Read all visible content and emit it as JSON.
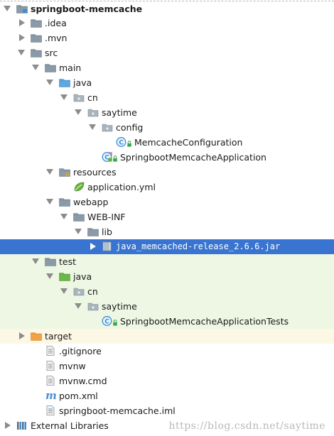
{
  "tree": [
    {
      "label": "springboot-memcache",
      "level": 0,
      "arrow": "open",
      "icon": "module-folder-icon",
      "bold": true,
      "top": true
    },
    {
      "label": ".idea",
      "level": 1,
      "arrow": "closed",
      "icon": "folder-icon"
    },
    {
      "label": ".mvn",
      "level": 1,
      "arrow": "closed",
      "icon": "folder-icon"
    },
    {
      "label": "src",
      "level": 1,
      "arrow": "open",
      "icon": "folder-icon"
    },
    {
      "label": "main",
      "level": 2,
      "arrow": "open",
      "icon": "folder-icon"
    },
    {
      "label": "java",
      "level": 3,
      "arrow": "open",
      "icon": "source-folder-icon"
    },
    {
      "label": "cn",
      "level": 4,
      "arrow": "open",
      "icon": "package-icon"
    },
    {
      "label": "saytime",
      "level": 5,
      "arrow": "open",
      "icon": "package-icon"
    },
    {
      "label": "config",
      "level": 6,
      "arrow": "open",
      "icon": "package-icon"
    },
    {
      "label": "MemcacheConfiguration",
      "level": 7,
      "arrow": "none",
      "icon": "class-icon",
      "lock": true
    },
    {
      "label": "SpringbootMemcacheApplication",
      "level": 6,
      "arrow": "none",
      "icon": "spring-boot-class-icon",
      "lock": true
    },
    {
      "label": "resources",
      "level": 3,
      "arrow": "open",
      "icon": "resources-folder-icon"
    },
    {
      "label": "application.yml",
      "level": 4,
      "arrow": "none",
      "icon": "spring-leaf-icon"
    },
    {
      "label": "webapp",
      "level": 3,
      "arrow": "open",
      "icon": "folder-icon"
    },
    {
      "label": "WEB-INF",
      "level": 4,
      "arrow": "open",
      "icon": "folder-icon"
    },
    {
      "label": "lib",
      "level": 5,
      "arrow": "open",
      "icon": "folder-icon"
    },
    {
      "label": "java_memcached-release_2.6.6.jar",
      "level": 6,
      "arrow": "closed",
      "icon": "jar-icon",
      "selected": true,
      "mono": true
    },
    {
      "label": "test",
      "level": 2,
      "arrow": "open",
      "icon": "folder-icon",
      "test": true
    },
    {
      "label": "java",
      "level": 3,
      "arrow": "open",
      "icon": "test-source-folder-icon",
      "test": true
    },
    {
      "label": "cn",
      "level": 4,
      "arrow": "open",
      "icon": "package-icon",
      "test": true
    },
    {
      "label": "saytime",
      "level": 5,
      "arrow": "open",
      "icon": "package-icon",
      "test": true
    },
    {
      "label": "SpringbootMemcacheApplicationTests",
      "level": 6,
      "arrow": "none",
      "icon": "class-icon",
      "lock": true,
      "test": true
    },
    {
      "label": "target",
      "level": 1,
      "arrow": "closed",
      "icon": "excluded-folder-icon",
      "excluded": true
    },
    {
      "label": ".gitignore",
      "level": 2,
      "arrow": "none",
      "icon": "text-file-icon"
    },
    {
      "label": "mvnw",
      "level": 2,
      "arrow": "none",
      "icon": "text-file-icon"
    },
    {
      "label": "mvnw.cmd",
      "level": 2,
      "arrow": "none",
      "icon": "text-file-icon"
    },
    {
      "label": "pom.xml",
      "level": 2,
      "arrow": "none",
      "icon": "maven-icon"
    },
    {
      "label": "springboot-memcache.iml",
      "level": 2,
      "arrow": "none",
      "icon": "iml-file-icon"
    },
    {
      "label": "External Libraries",
      "level": 0,
      "arrow": "closed",
      "icon": "libraries-icon"
    }
  ],
  "watermark": "https://blog.csdn.net/saytime",
  "colors": {
    "selection": "#3874d0",
    "test_background": "#eef7e4",
    "excluded_background": "#fdf8e6",
    "folder": "#8a9aa8",
    "source_folder": "#5fa7dd",
    "test_folder": "#6db64a",
    "excluded_folder": "#f0a346",
    "class": "#3c8fd6",
    "spring": "#6bb33f"
  }
}
